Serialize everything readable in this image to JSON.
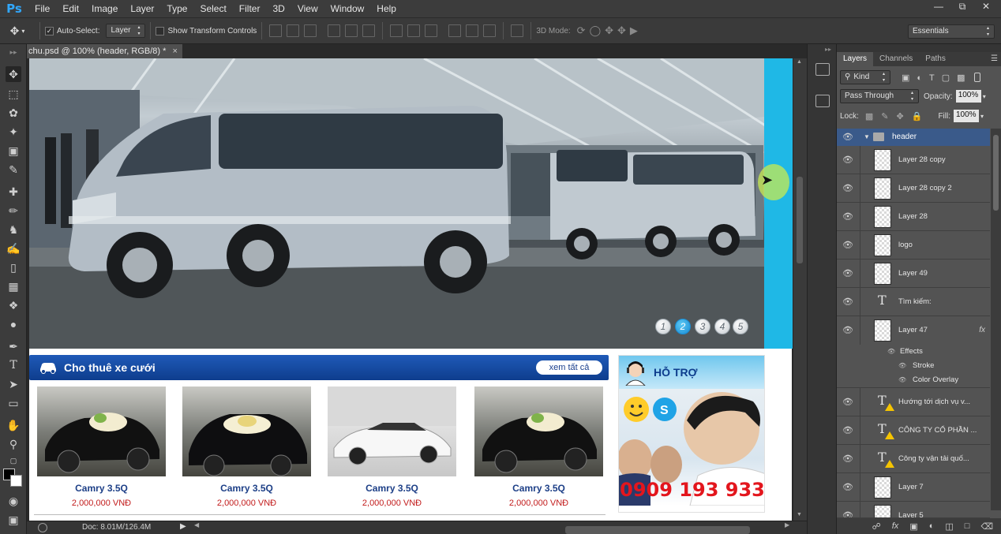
{
  "app": {
    "logo": "Ps",
    "menu": [
      "File",
      "Edit",
      "Image",
      "Layer",
      "Type",
      "Select",
      "Filter",
      "3D",
      "View",
      "Window",
      "Help"
    ],
    "window_controls": [
      "—",
      "⧉",
      "✕"
    ]
  },
  "options_bar": {
    "auto_select_label": "Auto-Select:",
    "auto_select_checked": true,
    "auto_select_target": "Layer",
    "show_transform_label": "Show Transform Controls",
    "mode_3d_label": "3D Mode:",
    "workspace": "Essentials"
  },
  "document": {
    "tab_title": "chu.psd @ 100% (header, RGB/8) *",
    "tab_close": "×",
    "doc_info": "Doc: 8.01M/126.4M"
  },
  "canvas": {
    "slider_dots": [
      "1",
      "2",
      "3",
      "4",
      "5"
    ],
    "active_dot": "2",
    "rental_title": "Cho thuê xe cưới",
    "view_all": "xem tất cả",
    "cards": [
      {
        "name": "Camry 3.5Q",
        "price": "2,000,000 VNĐ"
      },
      {
        "name": "Camry 3.5Q",
        "price": "2,000,000 VNĐ"
      },
      {
        "name": "Camry 3.5Q",
        "price": "2,000,000 VNĐ"
      },
      {
        "name": "Camry 3.5Q",
        "price": "2,000,000 VNĐ"
      }
    ],
    "support_title": "HỖ TRỢ",
    "hotline": "0909 193 933"
  },
  "layers_panel": {
    "tabs": [
      "Layers",
      "Channels",
      "Paths"
    ],
    "filter_kind": "Kind",
    "blend_mode": "Pass Through",
    "opacity_label": "Opacity:",
    "opacity": "100%",
    "lock_label": "Lock:",
    "fill_label": "Fill:",
    "fill": "100%",
    "group_name": "header",
    "layers": [
      {
        "name": "Layer 28 copy",
        "kind": "pixel"
      },
      {
        "name": "Layer 28 copy 2",
        "kind": "pixel"
      },
      {
        "name": "Layer 28",
        "kind": "pixel"
      },
      {
        "name": "logo",
        "kind": "pixel"
      },
      {
        "name": "Layer 49",
        "kind": "pixel"
      },
      {
        "name": "Tìm kiếm:",
        "kind": "type"
      },
      {
        "name": "Layer 47",
        "kind": "pixel",
        "fx": "fx"
      },
      {
        "name": "Hướng tới dịch vụ v...",
        "kind": "type-warn"
      },
      {
        "name": "CÔNG TY CỔ PHẦN ...",
        "kind": "type-warn"
      },
      {
        "name": "Công ty vận tải quố...",
        "kind": "type-warn"
      },
      {
        "name": "Layer 7",
        "kind": "pixel"
      },
      {
        "name": "Layer 5",
        "kind": "pixel"
      }
    ],
    "effects": {
      "label": "Effects",
      "items": [
        "Stroke",
        "Color Overlay"
      ]
    }
  },
  "colors": {
    "accent_blue": "#1f5ab8",
    "cyan": "#1fb8e6",
    "price_red": "#c21b1b",
    "hotline_red": "#e3161d"
  }
}
